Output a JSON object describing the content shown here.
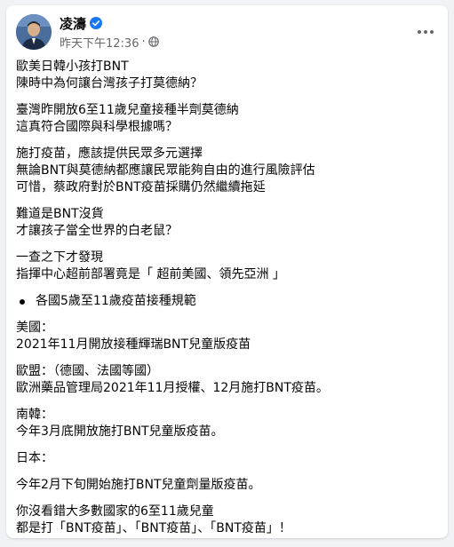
{
  "post": {
    "author": "凌濤",
    "timestamp": "昨天下午12:36",
    "dot": "·",
    "paragraphs": [
      [
        "歐美日韓小孩打BNT",
        "陳時中為何讓台灣孩子打莫德納？"
      ],
      [
        "臺灣昨開放6至11歲兒童接種半劑莫德納",
        "這真符合國際與科學根據嗎？"
      ],
      [
        "施打疫苗，應該提供民眾多元選擇",
        "無論BNT與莫德納都應讓民眾能夠自由的進行風險評估",
        "可惜，蔡政府對於BNT疫苗採購仍然繼續拖延"
      ],
      [
        "難道是BNT沒貨",
        "才讓孩子當全世界的白老鼠？"
      ],
      [
        "一查之下才發現",
        "指揮中心超前部署竟是「 超前美國、領先亞洲 」"
      ]
    ],
    "bullet": "各國5歲至11歲疫苗接種規範",
    "countries": [
      [
        "美國：",
        "2021年11月開放接種輝瑞BNT兒童版疫苗"
      ],
      [
        "歐盟：（德國、法國等國）",
        "歐洲藥品管理局2021年11月授權、12月施打BNT疫苗。"
      ],
      [
        "南韓：",
        "今年3月底開放施打BNT兒童版疫苗。"
      ],
      [
        "日本："
      ],
      [
        "今年2月下旬開始施打BNT兒童劑量版疫苗。"
      ],
      [
        "你沒看錯大多數國家的6至11歲兒童",
        "都是打「BNT疫苗」、「BNT疫苗」、「BNT疫苗」！"
      ]
    ]
  },
  "colors": {
    "background": "#f0f2f5",
    "card": "#ffffff",
    "verified": "#1877f2",
    "secondary_text": "#65676b"
  },
  "icons": [
    "verified-badge-icon",
    "globe-icon",
    "more-options-icon"
  ]
}
